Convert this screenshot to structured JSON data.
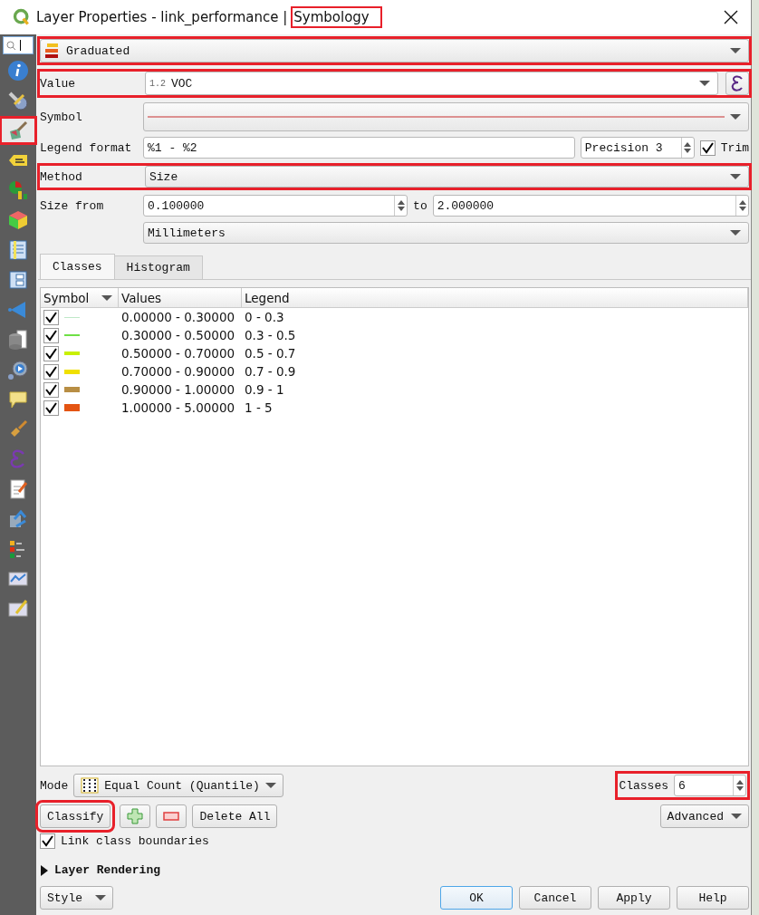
{
  "window": {
    "title": "Layer Properties - link_performance | ",
    "title_tail": {
      "text": "Symbology",
      "highlighted": true
    }
  },
  "sidebar": {
    "items": [
      {
        "kind": "info",
        "selected": false,
        "highlighted": false
      },
      {
        "kind": "source",
        "selected": false,
        "highlighted": false
      },
      {
        "kind": "symbology",
        "selected": true,
        "highlighted": true
      },
      {
        "kind": "labels",
        "selected": false,
        "highlighted": false
      },
      {
        "kind": "diagrams",
        "selected": false,
        "highlighted": false
      },
      {
        "kind": "cube",
        "selected": false,
        "highlighted": false
      },
      {
        "kind": "fields",
        "selected": false,
        "highlighted": false
      },
      {
        "kind": "form",
        "selected": false,
        "highlighted": false
      },
      {
        "kind": "joins",
        "selected": false,
        "highlighted": false
      },
      {
        "kind": "storage",
        "selected": false,
        "highlighted": false
      },
      {
        "kind": "actions",
        "selected": false,
        "highlighted": false
      },
      {
        "kind": "display",
        "selected": false,
        "highlighted": false
      },
      {
        "kind": "rendering",
        "selected": false,
        "highlighted": false
      },
      {
        "kind": "variables",
        "selected": false,
        "highlighted": false
      },
      {
        "kind": "metadata",
        "selected": false,
        "highlighted": false
      },
      {
        "kind": "dependencies",
        "selected": false,
        "highlighted": false
      },
      {
        "kind": "legend",
        "selected": false,
        "highlighted": false
      },
      {
        "kind": "server",
        "selected": false,
        "highlighted": false
      },
      {
        "kind": "digitizing",
        "selected": false,
        "highlighted": false
      }
    ]
  },
  "renderer": {
    "value": "Graduated",
    "highlighted": true
  },
  "value_field": {
    "label": "Value",
    "type_badge": "1.2",
    "value": "VOC",
    "highlighted": true
  },
  "symbol": {
    "label": "Symbol"
  },
  "legend_format": {
    "label": "Legend format",
    "value": "%1 - %2",
    "precision": "Precision 3",
    "trim": {
      "label": "Trim",
      "checked": true
    }
  },
  "method": {
    "label": "Method",
    "value": "Size",
    "highlighted": true
  },
  "size": {
    "label": "Size from",
    "from": "0.100000",
    "to_label": "to",
    "to": "2.000000",
    "unit": "Millimeters"
  },
  "tabs": [
    {
      "label": "Classes",
      "selected": true
    },
    {
      "label": "Histogram",
      "selected": false
    }
  ],
  "table": {
    "columns": [
      "Symbol",
      "Values",
      "Legend"
    ],
    "rows": [
      {
        "checked": true,
        "color": "#bfe8c8",
        "values": "0.00000 - 0.30000",
        "legend": "0 - 0.3"
      },
      {
        "checked": true,
        "color": "#6ee046",
        "values": "0.30000 - 0.50000",
        "legend": "0.3 - 0.5"
      },
      {
        "checked": true,
        "color": "#c8f000",
        "values": "0.50000 - 0.70000",
        "legend": "0.5 - 0.7"
      },
      {
        "checked": true,
        "color": "#f0e000",
        "values": "0.70000 - 0.90000",
        "legend": "0.7 - 0.9"
      },
      {
        "checked": true,
        "color": "#b88e44",
        "values": "0.90000 - 1.00000",
        "legend": "0.9 - 1"
      },
      {
        "checked": true,
        "color": "#e45412",
        "values": "1.00000 - 5.00000",
        "legend": "1 - 5"
      }
    ]
  },
  "mode": {
    "label": "Mode",
    "value": "Equal Count (Quantile)"
  },
  "classes": {
    "label": "Classes",
    "value": "6",
    "highlighted": true
  },
  "classify": {
    "label": "Classify",
    "highlighted": true
  },
  "delete_all": "Delete All",
  "advanced": "Advanced",
  "link_boundaries": {
    "label": "Link class boundaries",
    "checked": true
  },
  "layer_rendering": {
    "label": "Layer Rendering",
    "expanded": false
  },
  "style_button": "Style",
  "dialog_buttons": [
    {
      "label": "OK",
      "default": true
    },
    {
      "label": "Cancel",
      "default": false
    },
    {
      "label": "Apply",
      "default": false
    },
    {
      "label": "Help",
      "default": false
    }
  ]
}
